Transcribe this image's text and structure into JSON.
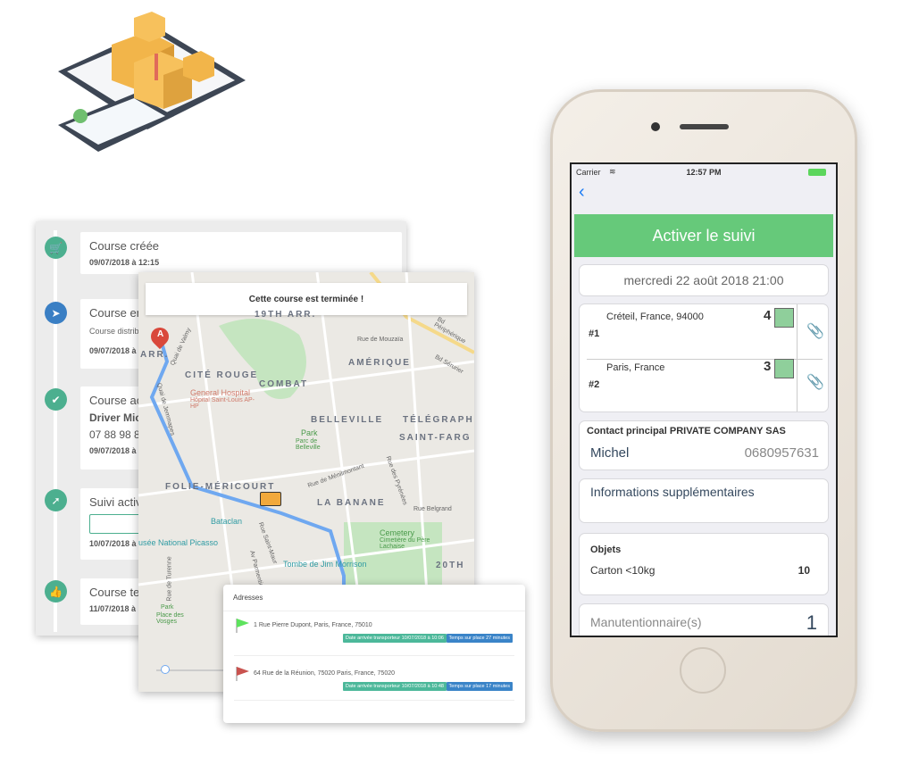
{
  "timeline": {
    "events": [
      {
        "title": "Course créée",
        "date": "09/07/2018 à 12:15",
        "icon": "cart-icon",
        "color": "#4caf8f"
      },
      {
        "title": "Course en",
        "sub": "Course distrib",
        "date": "09/07/2018 à",
        "icon": "paper-plane-icon",
        "color": "#3a7fc4"
      },
      {
        "title": "Course ac",
        "driver": "Driver Micl",
        "phone": "07 88 98 88",
        "date": "09/07/2018 à",
        "icon": "check-icon",
        "color": "#4caf8f"
      },
      {
        "title": "Suivi activ",
        "date": "10/07/2018 à",
        "icon": "location-arrow-icon",
        "color": "#4caf8f"
      },
      {
        "title": "Course te",
        "date": "11/07/2018 à",
        "icon": "thumbs-up-icon",
        "color": "#4caf8f"
      }
    ]
  },
  "map": {
    "banner": "Cette course est terminée !",
    "districts": [
      "19TH ARR.",
      "CITÉ ROUGE",
      "COMBAT",
      "AMÉRIQUE",
      "BELLEVILLE",
      "TÉLÉGRAPH",
      "SAINT-FARG",
      "FOLIE-MÉRICOURT",
      "LA BANANE",
      "20TH",
      "ARR."
    ],
    "places": [
      "General Hospital",
      "Hôpital Saint-Louis AP-HP",
      "Park",
      "Parc de Belleville",
      "Bataclan",
      "usée National Picasso",
      "Cemetery",
      "Cimetière du Père Lachaise",
      "Tombe de Jim Morrison",
      "Park",
      "Place des Vosges"
    ],
    "streets": [
      "Rue de Mouzaïa",
      "Bd Périphérique",
      "Bd Sérurier",
      "Rue de Ménilmontant",
      "Rue des Pyrénées",
      "Rue Belgrand",
      "Quai de Valmy",
      "Quai de Jemmapes",
      "Rue Saint-Maur",
      "Av Parmentier",
      "Rue de Turenne"
    ],
    "marker_label": "A",
    "route_color": "#6fa8f0"
  },
  "addresses": {
    "title": "Adresses",
    "items": [
      {
        "address": "1 Rue Pierre Dupont, Paris, France, 75010",
        "arrival": "Date arrivée transporteur 10/07/2018 à 10:06",
        "duration": "Temps sur place 27 minutes",
        "flag_color": "#5ee35e"
      },
      {
        "address": "64 Rue de la Réunion, 75020 Paris, France, 75020",
        "arrival": "Date arrivée transporteur 10/07/2018 à 10:48",
        "duration": "Temps sur place 17 minutes",
        "flag_color": "#c9534f"
      }
    ]
  },
  "phone": {
    "status": {
      "carrier": "Carrier",
      "time": "12:57 PM"
    },
    "activate_label": "Activer le suivi",
    "date": "mercredi 22 août 2018 21:00",
    "stops": [
      {
        "index": "#1",
        "address": "Créteil, France, 94000",
        "floor": "4"
      },
      {
        "index": "#2",
        "address": "Paris, France",
        "floor": "3"
      }
    ],
    "contact": {
      "label": "Contact principal PRIVATE COMPANY SAS",
      "name": "Michel",
      "phone": "0680957631"
    },
    "extra_info": "Informations supplémentaires",
    "objects": {
      "title": "Objets",
      "item": "Carton <10kg",
      "qty": "10"
    },
    "handlers": {
      "label": "Manutentionnaire(s)",
      "count": "1"
    },
    "accent": "#66c97a"
  }
}
